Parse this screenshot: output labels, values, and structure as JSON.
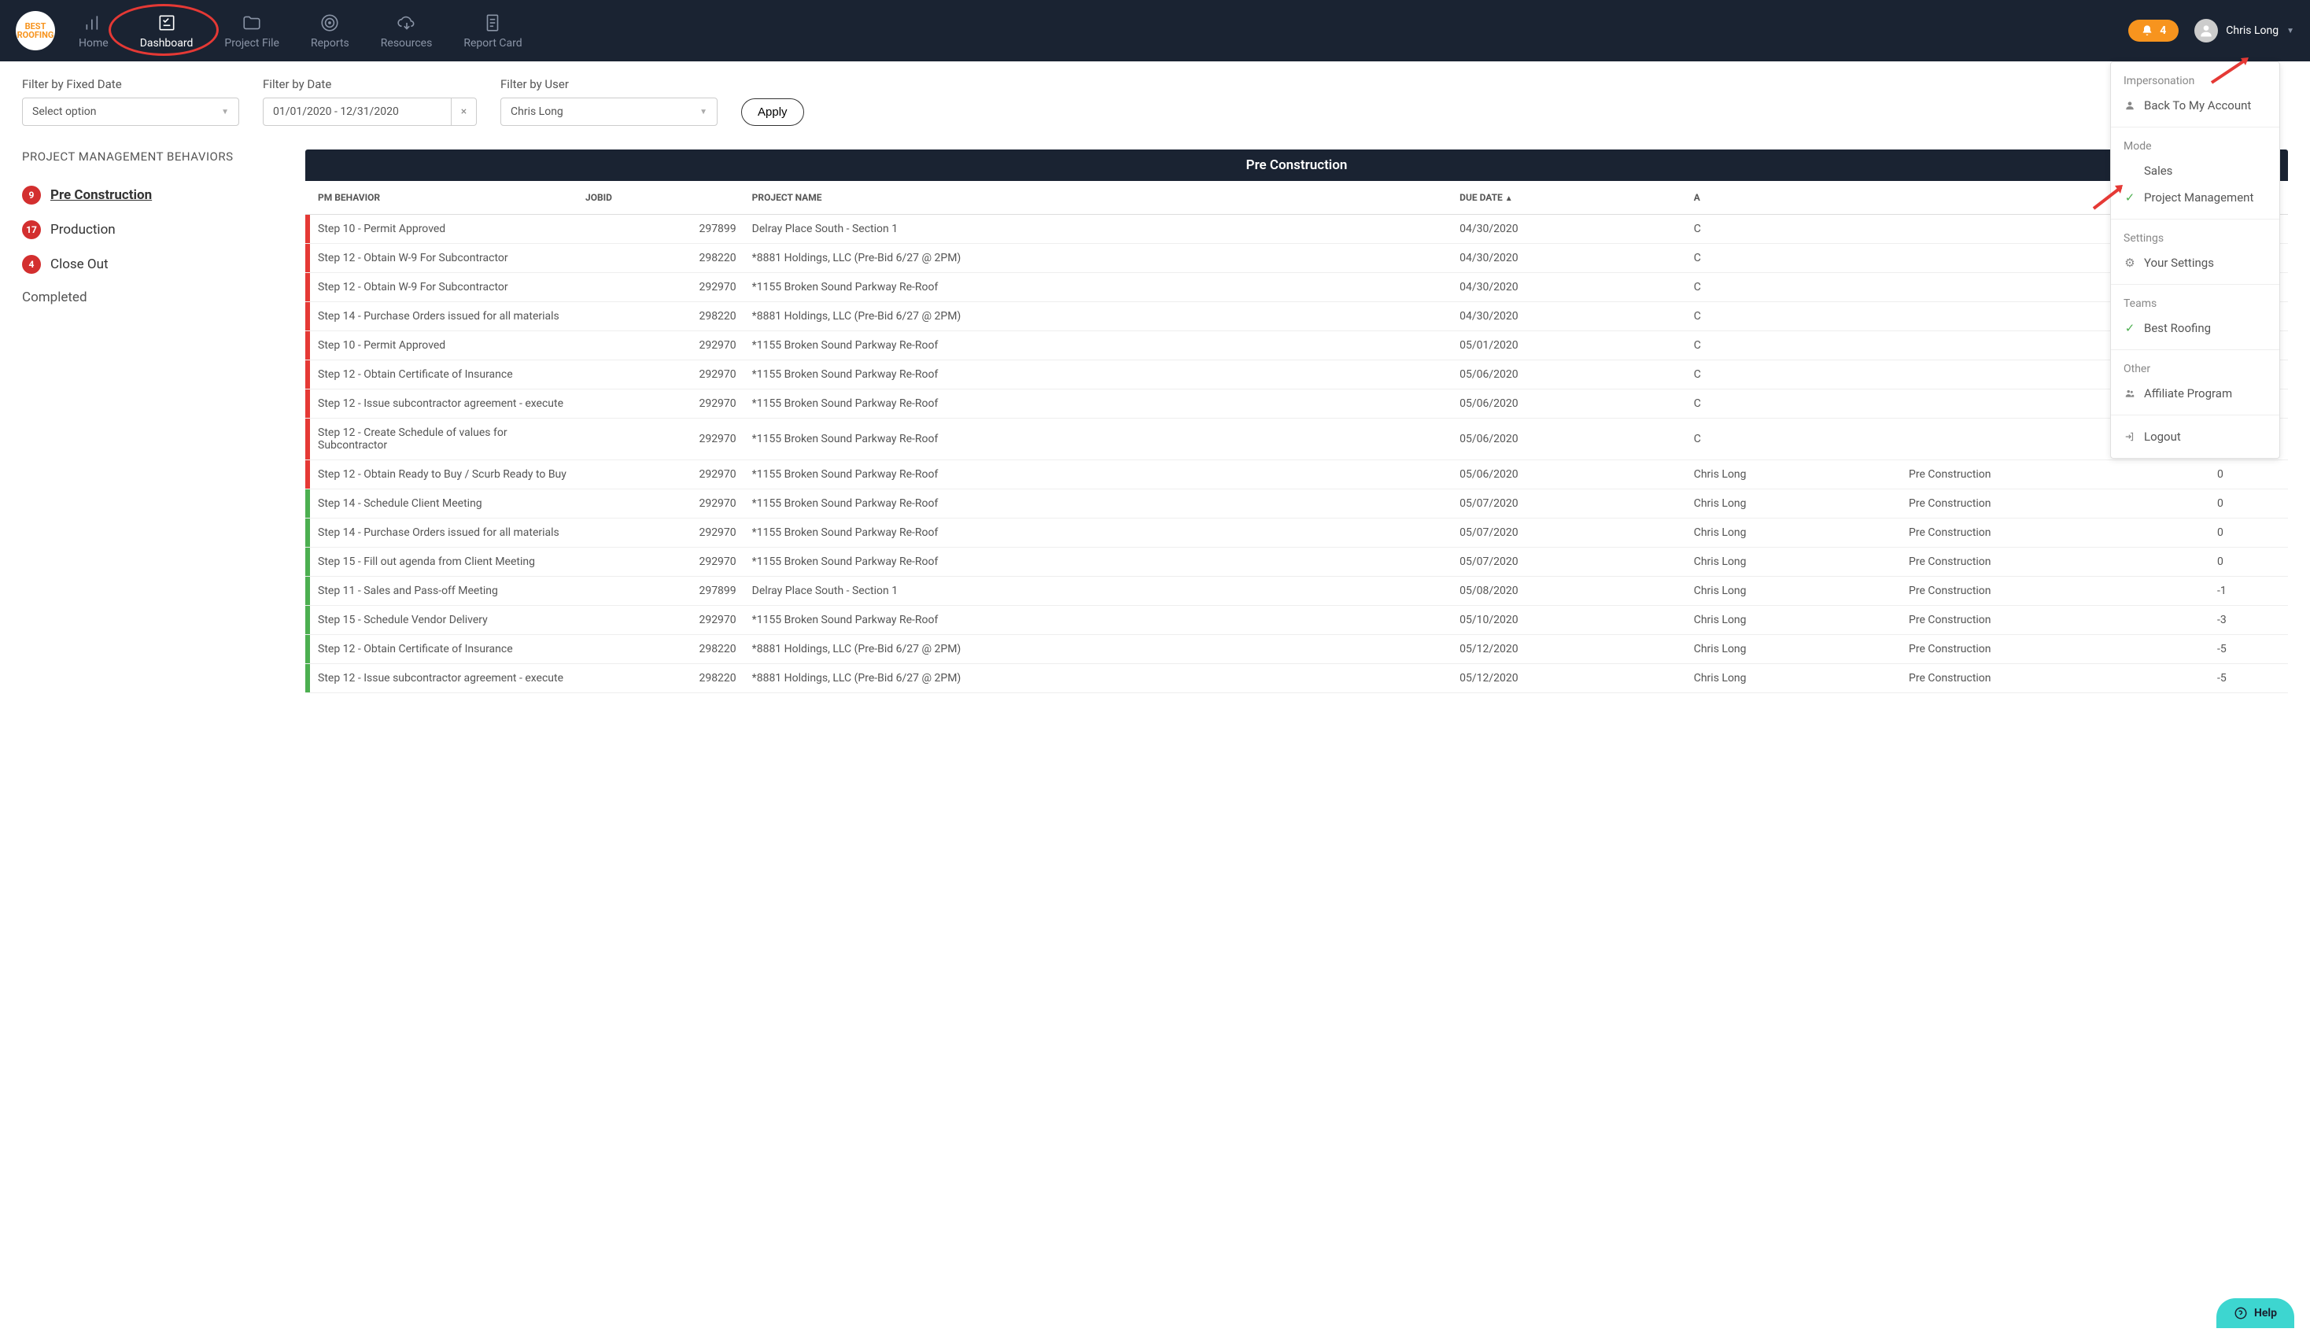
{
  "header": {
    "logo_text": "BEST ROOFING",
    "nav": [
      {
        "label": "Home"
      },
      {
        "label": "Dashboard"
      },
      {
        "label": "Project File"
      },
      {
        "label": "Reports"
      },
      {
        "label": "Resources"
      },
      {
        "label": "Report Card"
      }
    ],
    "notif_count": "4",
    "user_name": "Chris Long"
  },
  "dropdown": {
    "sections": [
      {
        "heading": "Impersonation",
        "items": [
          {
            "icon": "user-icon",
            "label": "Back To My Account"
          }
        ]
      },
      {
        "heading": "Mode",
        "items": [
          {
            "icon": "",
            "label": "Sales"
          },
          {
            "icon": "check",
            "label": "Project Management"
          }
        ]
      },
      {
        "heading": "Settings",
        "items": [
          {
            "icon": "gear",
            "label": "Your Settings"
          }
        ]
      },
      {
        "heading": "Teams",
        "items": [
          {
            "icon": "check",
            "label": "Best Roofing"
          }
        ]
      },
      {
        "heading": "Other",
        "items": [
          {
            "icon": "users",
            "label": "Affiliate Program"
          }
        ]
      },
      {
        "heading": "",
        "items": [
          {
            "icon": "logout",
            "label": "Logout"
          }
        ]
      }
    ]
  },
  "filters": {
    "fixed_date_label": "Filter by Fixed Date",
    "fixed_date_placeholder": "Select option",
    "date_label": "Filter by Date",
    "date_value": "01/01/2020 - 12/31/2020",
    "user_label": "Filter by User",
    "user_value": "Chris Long",
    "apply_label": "Apply"
  },
  "sidebar": {
    "title": "PROJECT MANAGEMENT BEHAVIORS",
    "items": [
      {
        "count": "9",
        "label": "Pre Construction",
        "active": true
      },
      {
        "count": "17",
        "label": "Production"
      },
      {
        "count": "4",
        "label": "Close Out"
      },
      {
        "label": "Completed",
        "completed": true
      }
    ]
  },
  "table": {
    "title": "Pre Construction",
    "headers": {
      "pm": "PM BEHAVIOR",
      "jobid": "JOBID",
      "project": "PROJECT NAME",
      "due": "DUE DATE",
      "assigned": "A",
      "stage": "",
      "days": ""
    },
    "rows": [
      {
        "status": "red",
        "pm": "Step 10 - Permit Approved",
        "jobid": "297899",
        "project": "Delray Place South - Section 1",
        "due": "04/30/2020",
        "assigned": "C"
      },
      {
        "status": "red",
        "pm": "Step 12 - Obtain W-9 For Subcontractor",
        "jobid": "298220",
        "project": "*8881 Holdings, LLC (Pre-Bid 6/27 @ 2PM)",
        "due": "04/30/2020",
        "assigned": "C"
      },
      {
        "status": "red",
        "pm": "Step 12 - Obtain W-9 For Subcontractor",
        "jobid": "292970",
        "project": "*1155 Broken Sound Parkway Re-Roof",
        "due": "04/30/2020",
        "assigned": "C"
      },
      {
        "status": "red",
        "pm": "Step 14 - Purchase Orders issued for all materials",
        "jobid": "298220",
        "project": "*8881 Holdings, LLC (Pre-Bid 6/27 @ 2PM)",
        "due": "04/30/2020",
        "assigned": "C"
      },
      {
        "status": "red",
        "pm": "Step 10 - Permit Approved",
        "jobid": "292970",
        "project": "*1155 Broken Sound Parkway Re-Roof",
        "due": "05/01/2020",
        "assigned": "C"
      },
      {
        "status": "red",
        "pm": "Step 12 - Obtain Certificate of Insurance",
        "jobid": "292970",
        "project": "*1155 Broken Sound Parkway Re-Roof",
        "due": "05/06/2020",
        "assigned": "C"
      },
      {
        "status": "red",
        "pm": "Step 12 - Issue subcontractor agreement - execute",
        "jobid": "292970",
        "project": "*1155 Broken Sound Parkway Re-Roof",
        "due": "05/06/2020",
        "assigned": "C"
      },
      {
        "status": "red",
        "pm": "Step 12 - Create Schedule of values for Subcontractor",
        "jobid": "292970",
        "project": "*1155 Broken Sound Parkway Re-Roof",
        "due": "05/06/2020",
        "assigned": "C"
      },
      {
        "status": "red",
        "pm": "Step 12 - Obtain Ready to Buy / Scurb Ready to Buy",
        "jobid": "292970",
        "project": "*1155 Broken Sound Parkway Re-Roof",
        "due": "05/06/2020",
        "assigned": "Chris Long",
        "stage": "Pre Construction",
        "days": "0"
      },
      {
        "status": "green",
        "pm": "Step 14 - Schedule Client Meeting",
        "jobid": "292970",
        "project": "*1155 Broken Sound Parkway Re-Roof",
        "due": "05/07/2020",
        "assigned": "Chris Long",
        "stage": "Pre Construction",
        "days": "0"
      },
      {
        "status": "green",
        "pm": "Step 14 - Purchase Orders issued for all materials",
        "jobid": "292970",
        "project": "*1155 Broken Sound Parkway Re-Roof",
        "due": "05/07/2020",
        "assigned": "Chris Long",
        "stage": "Pre Construction",
        "days": "0"
      },
      {
        "status": "green",
        "pm": "Step 15 - Fill out agenda from Client Meeting",
        "jobid": "292970",
        "project": "*1155 Broken Sound Parkway Re-Roof",
        "due": "05/07/2020",
        "assigned": "Chris Long",
        "stage": "Pre Construction",
        "days": "0"
      },
      {
        "status": "green",
        "pm": "Step 11 - Sales and Pass-off Meeting",
        "jobid": "297899",
        "project": "Delray Place South - Section 1",
        "due": "05/08/2020",
        "assigned": "Chris Long",
        "stage": "Pre Construction",
        "days": "-1"
      },
      {
        "status": "green",
        "pm": "Step 15 - Schedule Vendor Delivery",
        "jobid": "292970",
        "project": "*1155 Broken Sound Parkway Re-Roof",
        "due": "05/10/2020",
        "assigned": "Chris Long",
        "stage": "Pre Construction",
        "days": "-3"
      },
      {
        "status": "green",
        "pm": "Step 12 - Obtain Certificate of Insurance",
        "jobid": "298220",
        "project": "*8881 Holdings, LLC (Pre-Bid 6/27 @ 2PM)",
        "due": "05/12/2020",
        "assigned": "Chris Long",
        "stage": "Pre Construction",
        "days": "-5"
      },
      {
        "status": "green",
        "pm": "Step 12 - Issue subcontractor agreement - execute",
        "jobid": "298220",
        "project": "*8881 Holdings, LLC (Pre-Bid 6/27 @ 2PM)",
        "due": "05/12/2020",
        "assigned": "Chris Long",
        "stage": "Pre Construction",
        "days": "-5"
      }
    ]
  },
  "help_label": "Help"
}
